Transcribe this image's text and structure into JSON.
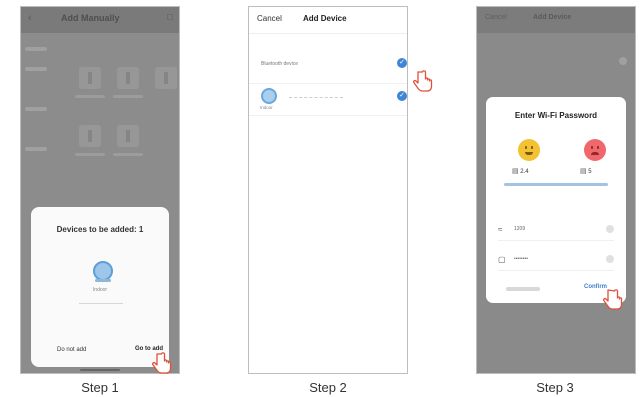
{
  "step1": {
    "caption": "Step 1",
    "title": "Add Manually",
    "sheet_title": "Devices to be added: 1",
    "btn_dont_add": "Do not add",
    "btn_go_to_add": "Go to add",
    "device_label": "Indoor"
  },
  "step2": {
    "caption": "Step 2",
    "cancel": "Cancel",
    "title": "Add Device",
    "row1_label": "Bluetooth device",
    "device_label": "Indoor"
  },
  "step3": {
    "caption": "Step 3",
    "title": "Add Device",
    "cancel": "Cancel",
    "dialog_title": "Enter Wi-Fi Password",
    "band_ok": "2.4",
    "band_bad": "5",
    "wifi_value": "1209",
    "password_value": "••••••••",
    "confirm": "Confirm"
  },
  "colors": {
    "accent": "#3f86d4",
    "overlay": "#8c8c8c",
    "hand_outline": "#e0513c"
  }
}
